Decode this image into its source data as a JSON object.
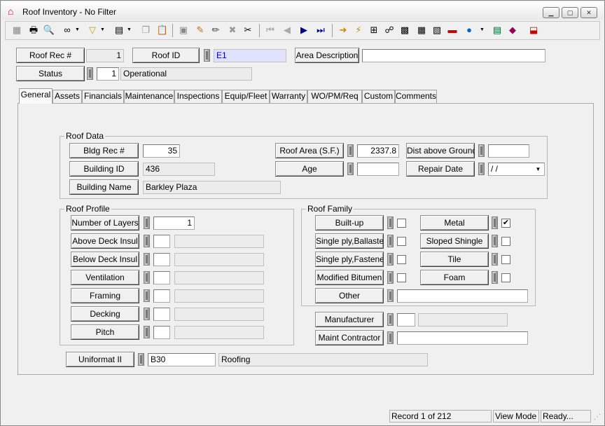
{
  "window": {
    "title": "Roof Inventory - No Filter",
    "app_icon": "roof-app-icon"
  },
  "toolbar": {
    "icons": [
      "grid-icon",
      "print-icon",
      "print-preview-icon",
      "binoculars-icon",
      "filter-icon",
      "new-record-icon",
      "copy-icon",
      "save-icon",
      "paste-icon",
      "edit-pencil-icon",
      "cancel-icon",
      "cut-icon",
      "first-record-icon",
      "prev-record-icon",
      "next-record-icon",
      "last-record-icon",
      "arrow-icon",
      "lightning-icon",
      "tree-icon",
      "image-icon",
      "calculator-icon",
      "chart-icon",
      "map-icon",
      "globe-icon",
      "keyboard-icon",
      "book-icon",
      "exit-icon"
    ]
  },
  "header": {
    "roof_rec_label": "Roof Rec #",
    "roof_rec_value": "1",
    "roof_id_label": "Roof ID",
    "roof_id_value": "E1",
    "area_desc_label": "Area Description",
    "area_desc_value": "",
    "status_label": "Status",
    "status_code": "1",
    "status_text": "Operational"
  },
  "tabs": [
    "General",
    "Assets",
    "Financials",
    "Maintenance",
    "Inspections",
    "Equip/Fleet",
    "Warranty",
    "WO/PM/Req",
    "Custom",
    "Comments"
  ],
  "roof_data": {
    "title": "Roof Data",
    "bldg_rec_label": "Bldg Rec #",
    "bldg_rec_value": "35",
    "building_id_label": "Building ID",
    "building_id_value": "436",
    "building_name_label": "Building Name",
    "building_name_value": "Barkley Plaza",
    "roof_area_label": "Roof Area (S.F.)",
    "roof_area_value": "2337.8",
    "age_label": "Age",
    "age_value": "",
    "dist_label": "Dist above Ground",
    "dist_value": "",
    "repair_date_label": "Repair Date",
    "repair_date_value": " /  /"
  },
  "roof_profile": {
    "title": "Roof Profile",
    "rows": [
      {
        "label": "Number of Layers",
        "value": "1"
      },
      {
        "label": "Above Deck Insul",
        "value": ""
      },
      {
        "label": "Below Deck Insul",
        "value": ""
      },
      {
        "label": "Ventilation",
        "value": ""
      },
      {
        "label": "Framing",
        "value": ""
      },
      {
        "label": "Decking",
        "value": ""
      },
      {
        "label": "Pitch",
        "value": ""
      }
    ]
  },
  "roof_family": {
    "title": "Roof Family",
    "left": [
      {
        "label": "Built-up",
        "checked": false
      },
      {
        "label": "Single ply,Ballasted",
        "checked": false
      },
      {
        "label": "Single ply,Fastened",
        "checked": false
      },
      {
        "label": "Modified Bitumen",
        "checked": false
      }
    ],
    "right": [
      {
        "label": "Metal",
        "checked": true
      },
      {
        "label": "Sloped Shingle",
        "checked": false
      },
      {
        "label": "Tile",
        "checked": false
      },
      {
        "label": "Foam",
        "checked": false
      }
    ],
    "other_label": "Other",
    "other_value": ""
  },
  "manufacturer_label": "Manufacturer",
  "manufacturer_code": "",
  "manufacturer_name": "",
  "maint_contractor_label": "Maint Contractor",
  "maint_contractor_value": "",
  "uniformat_label": "Uniformat II",
  "uniformat_code": "B30",
  "uniformat_name": "Roofing",
  "status_bar": {
    "record": "Record 1 of 212",
    "mode": "View Mode",
    "state": "Ready..."
  }
}
